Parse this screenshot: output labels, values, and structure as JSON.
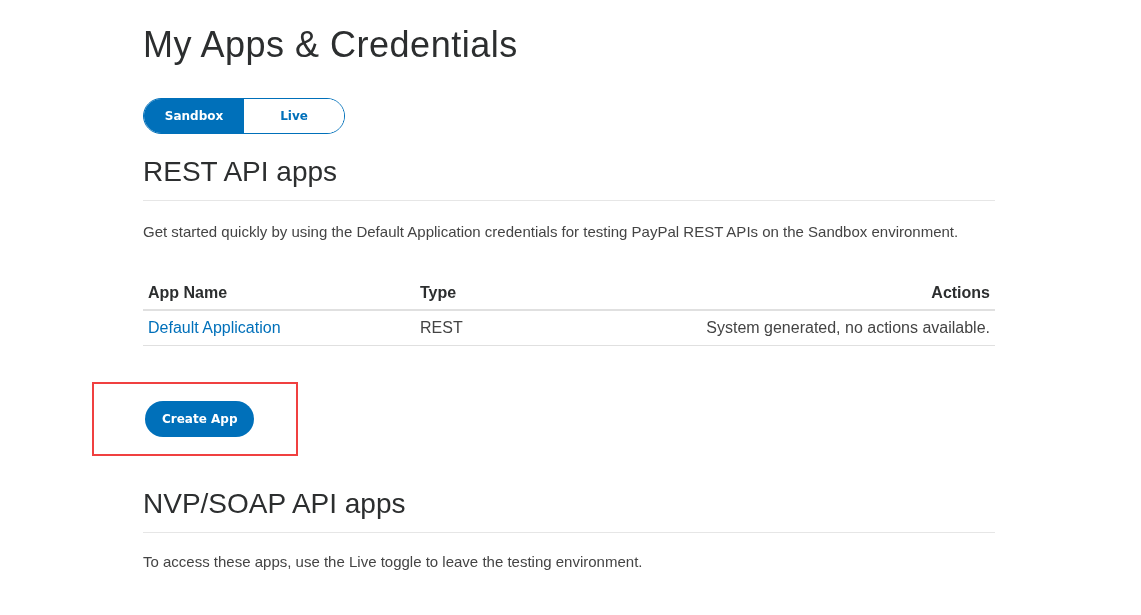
{
  "title": "My Apps & Credentials",
  "environment_toggle": [
    {
      "label": "Sandbox",
      "selected": true
    },
    {
      "label": "Live",
      "selected": false
    }
  ],
  "rest_section": {
    "heading": "REST API apps",
    "description": "Get started quickly by using the Default Application credentials for testing PayPal REST APIs on the Sandbox environment.",
    "table": {
      "columns": [
        "App Name",
        "Type",
        "Actions"
      ],
      "rows": [
        {
          "app_name": "Default Application",
          "type": "REST",
          "actions": "System generated, no actions available."
        }
      ]
    },
    "create_button": {
      "label": "Create App",
      "highlighted": true
    }
  },
  "nvp_section": {
    "heading": "NVP/SOAP API apps",
    "description": "To access these apps, use the Live toggle to leave the testing environment."
  }
}
